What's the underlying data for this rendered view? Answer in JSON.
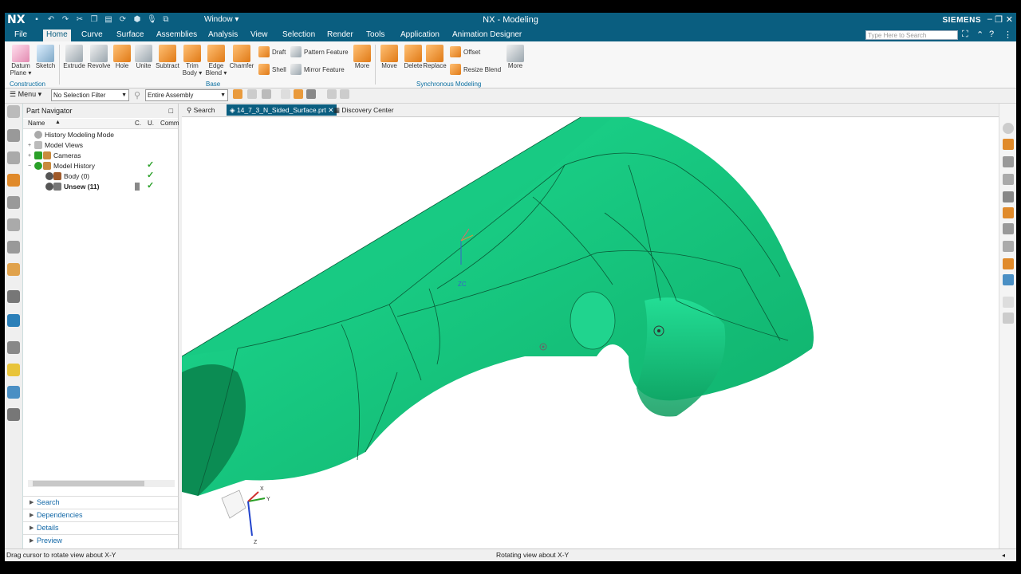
{
  "app": {
    "logo": "NX",
    "title": "NX - Modeling",
    "brand": "SIEMENS",
    "window_menu": "Window ▾",
    "search_placeholder": "Type Here to Search"
  },
  "menu": {
    "items": [
      "File",
      "Home",
      "Curve",
      "Surface",
      "Assemblies",
      "Analysis",
      "View",
      "Selection",
      "Render",
      "Tools",
      "Application",
      "Animation Designer"
    ],
    "active": "Home"
  },
  "ribbon": {
    "construction": {
      "label": "Construction",
      "datum_plane": "Datum Plane ▾",
      "sketch": "Sketch"
    },
    "base": {
      "label": "Base",
      "extrude": "Extrude",
      "revolve": "Revolve",
      "hole": "Hole",
      "unite": "Unite",
      "subtract": "Subtract",
      "trim_body": "Trim Body ▾",
      "edge_blend": "Edge Blend ▾",
      "chamfer": "Chamfer",
      "draft": "Draft",
      "shell": "Shell",
      "pattern_feature": "Pattern Feature",
      "mirror_feature": "Mirror Feature",
      "more": "More"
    },
    "sync": {
      "label": "Synchronous Modeling",
      "move": "Move",
      "delete": "Delete",
      "replace": "Replace",
      "offset": "Offset",
      "resize_blend": "Resize Blend",
      "more": "More"
    }
  },
  "toolbar": {
    "menu": "Menu ▾",
    "selection_filter": "No Selection Filter",
    "assembly_scope": "Entire Assembly"
  },
  "navigator": {
    "title": "Part Navigator",
    "columns": {
      "name": "Name",
      "c": "C.",
      "u": "U.",
      "comment": "Comm"
    },
    "tree": [
      {
        "label": "History Modeling Mode",
        "indent": 0
      },
      {
        "label": "Model Views",
        "indent": 0
      },
      {
        "label": "Cameras",
        "indent": 0
      },
      {
        "label": "Model History",
        "indent": 0
      },
      {
        "label": "Body (0)",
        "indent": 1
      },
      {
        "label": "Unsew (11)",
        "indent": 1
      }
    ],
    "panels": [
      "Search",
      "Dependencies",
      "Details",
      "Preview"
    ]
  },
  "tabs": {
    "search": "Search",
    "file": "14_7_3_N_Sided_Surface.prt",
    "discovery": "Discovery Center"
  },
  "viewport": {
    "model_color": "#1fd08a",
    "csys_label": "ZC",
    "triad": {
      "x": "X",
      "y": "Y",
      "z": "Z"
    }
  },
  "status": {
    "left": "Drag cursor to rotate view about X-Y",
    "center": "Rotating view about X-Y"
  }
}
